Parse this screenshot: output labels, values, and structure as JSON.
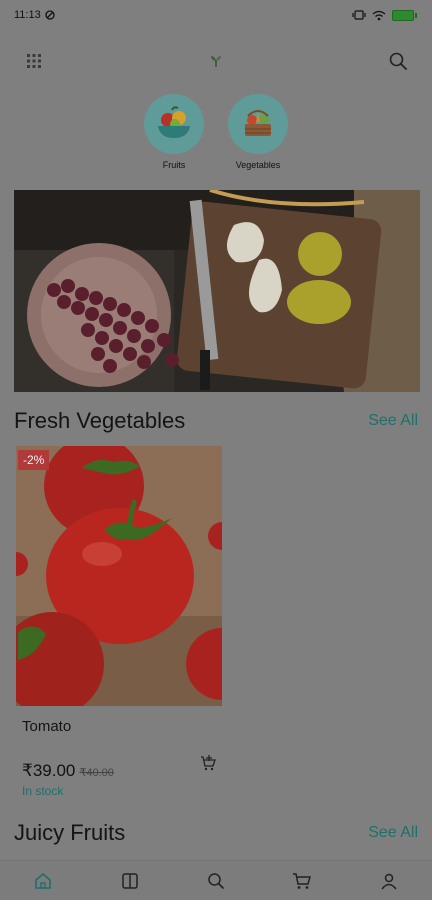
{
  "status": {
    "time": "11:13"
  },
  "header": {
    "menu_icon": "grid-menu-icon",
    "logo_icon": "leaf-logo-icon",
    "search_icon": "search-icon"
  },
  "categories": [
    {
      "label": "Fruits",
      "icon": "fruit-bowl-icon"
    },
    {
      "label": "Vegetables",
      "icon": "vegetable-basket-icon"
    }
  ],
  "banner": {
    "image": "grapes-and-pears-photo"
  },
  "sections": {
    "fresh": {
      "title": "Fresh Vegetables",
      "see_all": "See All"
    },
    "juicy": {
      "title": "Juicy Fruits",
      "see_all": "See All"
    }
  },
  "products": [
    {
      "name": "Tomato",
      "price": "₹39.00",
      "old_price": "₹40.00",
      "discount": "-2%",
      "stock": "In stock"
    }
  ],
  "nav": [
    {
      "icon": "home-icon",
      "active": true
    },
    {
      "icon": "catalog-icon"
    },
    {
      "icon": "search-icon"
    },
    {
      "icon": "cart-icon"
    },
    {
      "icon": "profile-icon"
    }
  ],
  "colors": {
    "accent": "#1f6f6a",
    "badge": "#b03a39",
    "category_bg": "#5f9b99",
    "overlay_bg": "#7f7f7f"
  }
}
